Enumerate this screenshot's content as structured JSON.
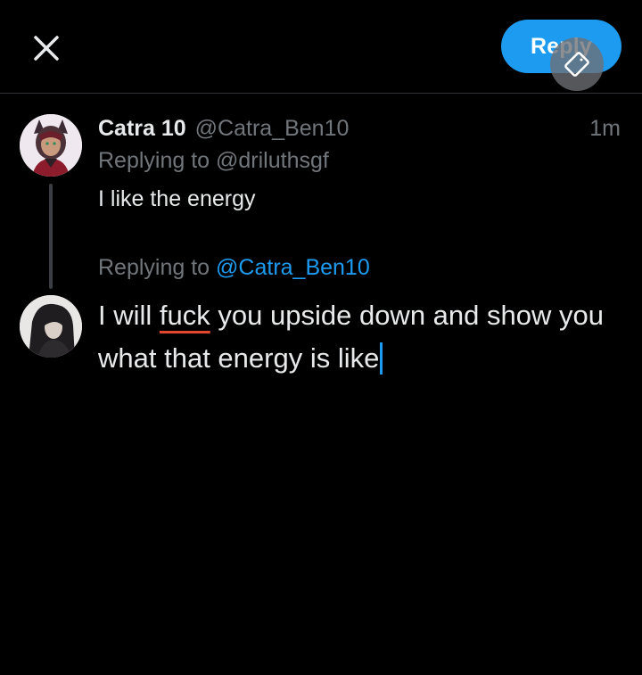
{
  "header": {
    "reply_label": "Reply",
    "close_icon": "close-icon",
    "rotate_icon": "rotate-screen-icon",
    "accent_color": "#1d9bf0"
  },
  "parent_tweet": {
    "display_name": "Catra 10",
    "handle": "@Catra_Ben10",
    "time": "1m",
    "replying_to": "Replying to @driluthsgf",
    "text": "I like the energy"
  },
  "reply_compose": {
    "replying_prefix": "Replying to",
    "replying_handle": "@Catra_Ben10",
    "text_before": "I will",
    "text_flagged": "fuck",
    "text_after": "you upside down and show you what that energy is like"
  }
}
